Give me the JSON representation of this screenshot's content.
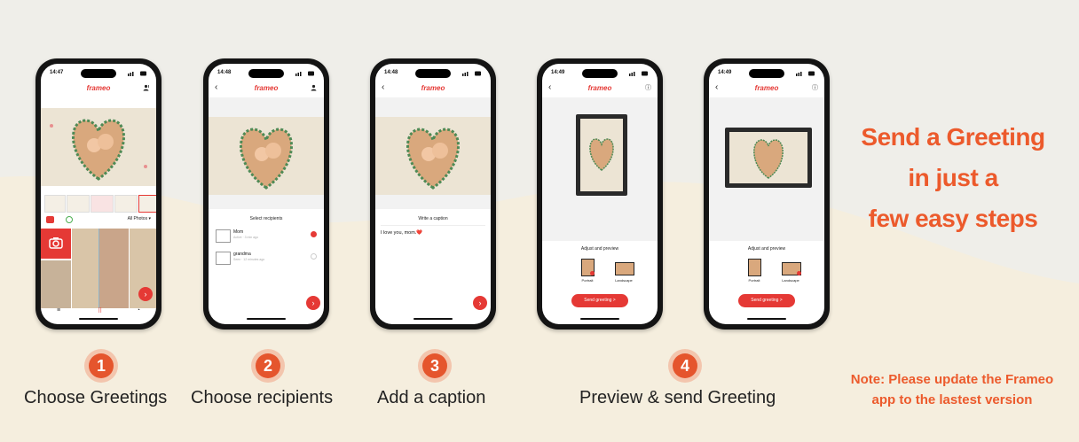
{
  "brand": {
    "name": "frameo",
    "accent": "#e53935",
    "headline_color": "#ec5a2c"
  },
  "headline": {
    "line1": "Send a Greeting",
    "line2": "in just a",
    "line3": "few easy steps"
  },
  "note": {
    "line1": "Note: Please update the Frameo",
    "line2": "app to the lastest version"
  },
  "steps": [
    {
      "number": "1",
      "label": "Choose Greetings"
    },
    {
      "number": "2",
      "label": "Choose recipients"
    },
    {
      "number": "3",
      "label": "Add a caption"
    },
    {
      "number": "4",
      "label": "Preview & send Greeting"
    }
  ],
  "phones": {
    "p1": {
      "time": "14:47",
      "album": "All Photos"
    },
    "p2": {
      "time": "14:48",
      "title": "Select recipients",
      "recipients": [
        {
          "name": "Mom",
          "sub": "Active · 3 min ago",
          "checked": true
        },
        {
          "name": "grandma",
          "sub": "Seen · 12 minutes ago",
          "checked": false
        }
      ]
    },
    "p3": {
      "time": "14:48",
      "title": "Write a caption",
      "caption": "I love you, mom.❤️"
    },
    "p4": {
      "time": "14:49",
      "title": "Adjust and preview",
      "portrait": "Portrait",
      "landscape": "Landscape",
      "send": "Send greeting  >"
    },
    "p5": {
      "time": "14:49",
      "title": "Adjust and preview",
      "portrait": "Portrait",
      "landscape": "Landscape",
      "send": "Send greeting  >"
    }
  }
}
